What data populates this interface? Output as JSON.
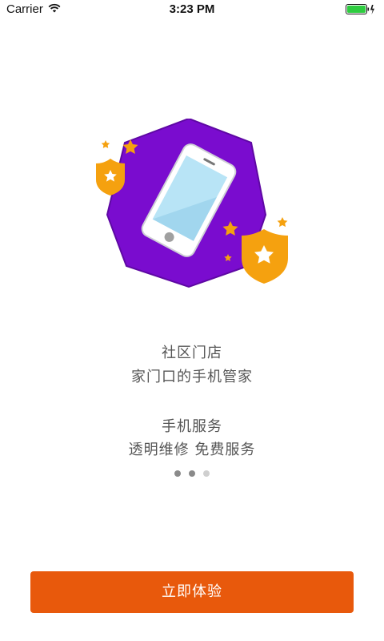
{
  "status_bar": {
    "carrier": "Carrier",
    "time": "3:23 PM"
  },
  "onboarding": {
    "page1_title": "社区门店",
    "page1_subtitle": "家门口的手机管家",
    "page2_title": "手机服务",
    "page2_subtitle": "透明维修 免费服务",
    "pager": {
      "total": 3,
      "active_indices": [
        0,
        1
      ]
    }
  },
  "cta": {
    "label": "立即体验"
  },
  "colors": {
    "hexagon": "#7a0ccf",
    "badge": "#f5a10f",
    "button": "#e8590c",
    "text": "#555555"
  }
}
